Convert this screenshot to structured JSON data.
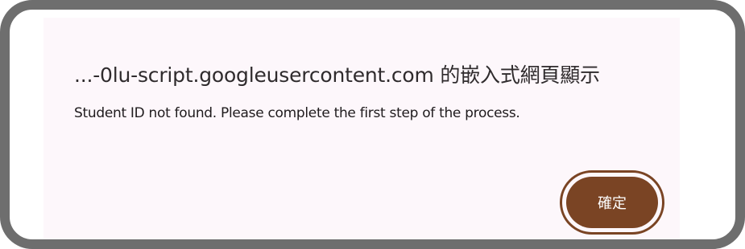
{
  "dialog": {
    "title": "...-0lu-script.googleusercontent.com 的嵌入式網頁顯示",
    "message": "Student ID not found. Please complete the first step of the process.",
    "ok_label": "確定"
  },
  "colors": {
    "dialog_background": "#fdf7fb",
    "button_background": "#7a4424",
    "frame_border": "#6e6e6e"
  }
}
